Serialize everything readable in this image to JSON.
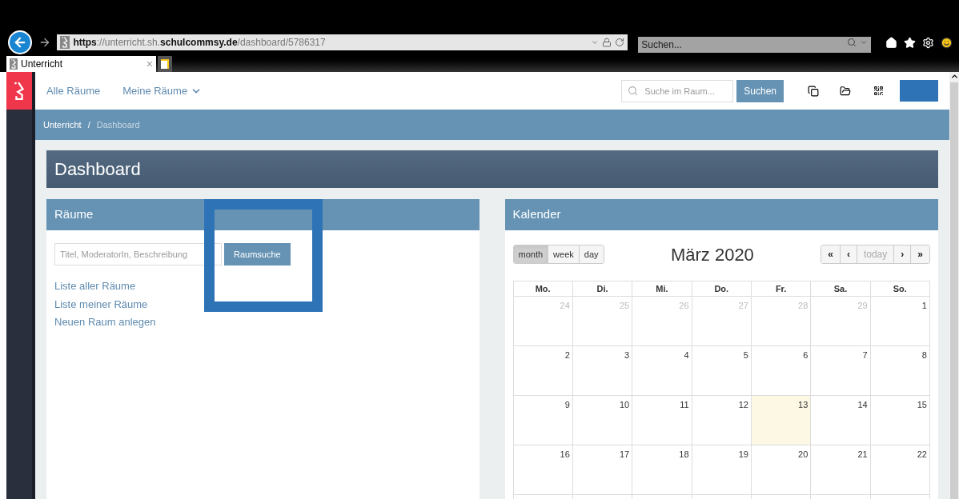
{
  "browser": {
    "url_parts": [
      {
        "text": "https",
        "strong": true
      },
      {
        "text": "://unterricht.sh.",
        "strong": false
      },
      {
        "text": "schulcommsy.de",
        "strong": true
      },
      {
        "text": "/dashboard/5786317",
        "strong": false
      }
    ],
    "search": {
      "placeholder": "Suchen..."
    },
    "tab": {
      "title": "Unterricht",
      "close": "×"
    }
  },
  "navbar": {
    "items": [
      {
        "label": "Alle Räume",
        "dropdown": false
      },
      {
        "label": "Meine Räume",
        "dropdown": true
      }
    ],
    "search": {
      "placeholder": "Suche im Raum...",
      "button": "Suchen"
    }
  },
  "breadcrumb": [
    {
      "label": "Unterricht",
      "current": false
    },
    {
      "label": "Dashboard",
      "current": true
    }
  ],
  "breadcrumb_separator": "/",
  "page_title": "Dashboard",
  "rooms_panel": {
    "title": "Räume",
    "search": {
      "placeholder": "Titel, ModeratorIn, Beschreibung",
      "button": "Raumsuche"
    },
    "links": [
      "Liste aller Räume",
      "Liste meiner Räume",
      "Neuen Raum anlegen"
    ]
  },
  "calendar_panel": {
    "title": "Kalender",
    "month_title": "März 2020",
    "views": [
      {
        "label": "month",
        "selected": true
      },
      {
        "label": "week",
        "selected": false
      },
      {
        "label": "day",
        "selected": false
      }
    ],
    "nav": [
      {
        "label": "«",
        "disabled": false
      },
      {
        "label": "‹",
        "disabled": false
      },
      {
        "label": "today",
        "disabled": true
      },
      {
        "label": "›",
        "disabled": false
      },
      {
        "label": "»",
        "disabled": false
      }
    ],
    "weekdays": [
      "Mo.",
      "Di.",
      "Mi.",
      "Do.",
      "Fr.",
      "Sa.",
      "So."
    ],
    "weeks": [
      [
        {
          "day": "24",
          "other_month": true,
          "today": false
        },
        {
          "day": "25",
          "other_month": true,
          "today": false
        },
        {
          "day": "26",
          "other_month": true,
          "today": false
        },
        {
          "day": "27",
          "other_month": true,
          "today": false
        },
        {
          "day": "28",
          "other_month": true,
          "today": false
        },
        {
          "day": "29",
          "other_month": true,
          "today": false
        },
        {
          "day": "1",
          "other_month": false,
          "today": false
        }
      ],
      [
        {
          "day": "2",
          "other_month": false,
          "today": false
        },
        {
          "day": "3",
          "other_month": false,
          "today": false
        },
        {
          "day": "4",
          "other_month": false,
          "today": false
        },
        {
          "day": "5",
          "other_month": false,
          "today": false
        },
        {
          "day": "6",
          "other_month": false,
          "today": false
        },
        {
          "day": "7",
          "other_month": false,
          "today": false
        },
        {
          "day": "8",
          "other_month": false,
          "today": false
        }
      ],
      [
        {
          "day": "9",
          "other_month": false,
          "today": false
        },
        {
          "day": "10",
          "other_month": false,
          "today": false
        },
        {
          "day": "11",
          "other_month": false,
          "today": false
        },
        {
          "day": "12",
          "other_month": false,
          "today": false
        },
        {
          "day": "13",
          "other_month": false,
          "today": true
        },
        {
          "day": "14",
          "other_month": false,
          "today": false
        },
        {
          "day": "15",
          "other_month": false,
          "today": false
        }
      ],
      [
        {
          "day": "16",
          "other_month": false,
          "today": false
        },
        {
          "day": "17",
          "other_month": false,
          "today": false
        },
        {
          "day": "18",
          "other_month": false,
          "today": false
        },
        {
          "day": "19",
          "other_month": false,
          "today": false
        },
        {
          "day": "20",
          "other_month": false,
          "today": false
        },
        {
          "day": "21",
          "other_month": false,
          "today": false
        },
        {
          "day": "22",
          "other_month": false,
          "today": false
        }
      ]
    ]
  }
}
